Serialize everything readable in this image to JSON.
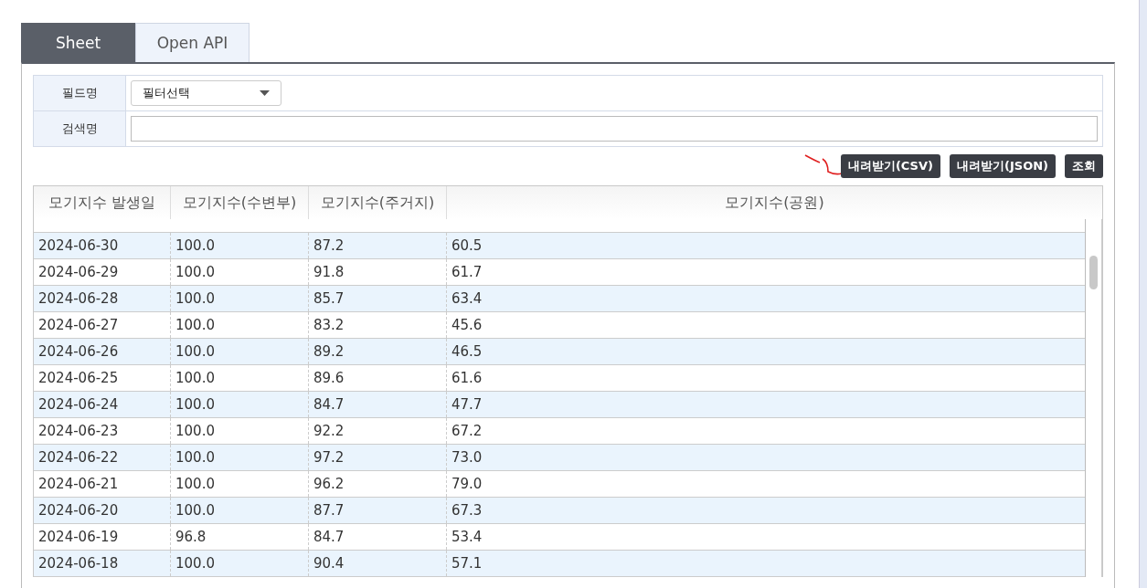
{
  "tabs": [
    {
      "label": "Sheet",
      "selected": true
    },
    {
      "label": "Open API",
      "selected": false
    }
  ],
  "filter": {
    "field_label": "필드명",
    "field_select": "필터선택",
    "search_label": "검색명"
  },
  "buttons": [
    "내려받기(CSV)",
    "내려받기(JSON)",
    "조회"
  ],
  "table": {
    "columns": [
      "모기지수 발생일",
      "모기지수(수변부)",
      "모기지수(주거지)",
      "모기지수(공원)"
    ],
    "rows": [
      [
        "2024-06-30",
        "100.0",
        "87.2",
        "60.5"
      ],
      [
        "2024-06-29",
        "100.0",
        "91.8",
        "61.7"
      ],
      [
        "2024-06-28",
        "100.0",
        "85.7",
        "63.4"
      ],
      [
        "2024-06-27",
        "100.0",
        "83.2",
        "45.6"
      ],
      [
        "2024-06-26",
        "100.0",
        "89.2",
        "46.5"
      ],
      [
        "2024-06-25",
        "100.0",
        "89.6",
        "61.6"
      ],
      [
        "2024-06-24",
        "100.0",
        "84.7",
        "47.7"
      ],
      [
        "2024-06-23",
        "100.0",
        "92.2",
        "67.2"
      ],
      [
        "2024-06-22",
        "100.0",
        "97.2",
        "73.0"
      ],
      [
        "2024-06-21",
        "100.0",
        "96.2",
        "79.0"
      ],
      [
        "2024-06-20",
        "100.0",
        "87.7",
        "67.3"
      ],
      [
        "2024-06-19",
        "96.8",
        "84.7",
        "53.4"
      ],
      [
        "2024-06-18",
        "100.0",
        "90.4",
        "57.1"
      ]
    ]
  }
}
